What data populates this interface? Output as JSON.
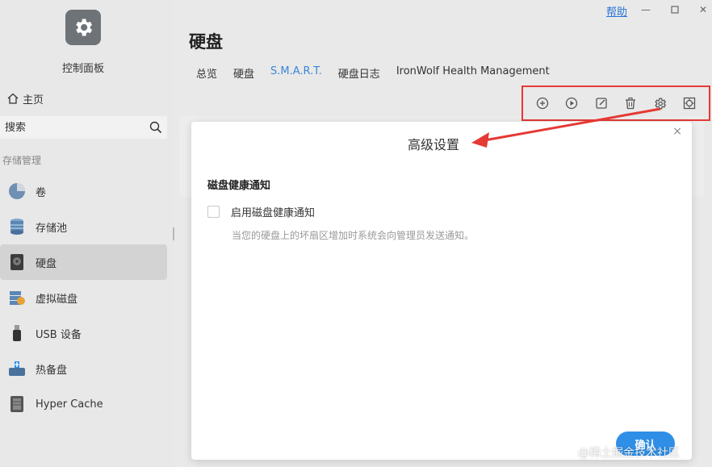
{
  "sidebar": {
    "app_title": "控制面板",
    "home_label": "主页",
    "search_placeholder": "搜索",
    "section_title": "存储管理",
    "items": [
      {
        "label": "卷",
        "icon": "pie-volume-icon"
      },
      {
        "label": "存储池",
        "icon": "storage-pool-icon"
      },
      {
        "label": "硬盘",
        "icon": "hard-disk-icon",
        "active": true
      },
      {
        "label": "虚拟磁盘",
        "icon": "virtual-disk-icon"
      },
      {
        "label": "USB 设备",
        "icon": "usb-icon"
      },
      {
        "label": "热备盘",
        "icon": "hot-spare-icon"
      },
      {
        "label": "Hyper Cache",
        "icon": "hyper-cache-icon"
      }
    ]
  },
  "header": {
    "help_label": "帮助",
    "page_title": "硬盘",
    "tabs": [
      {
        "label": "总览"
      },
      {
        "label": "硬盘"
      },
      {
        "label": "S.M.A.R.T.",
        "active": true
      },
      {
        "label": "硬盘日志"
      },
      {
        "label": "IronWolf Health Management"
      }
    ]
  },
  "toolbar": {
    "buttons": [
      "add-icon",
      "play-icon",
      "edit-icon",
      "trash-icon",
      "settings-icon",
      "locate-icon"
    ]
  },
  "modal": {
    "title": "高级设置",
    "close": "×",
    "section_title": "磁盘健康通知",
    "checkbox_label": "启用磁盘健康通知",
    "checkbox_checked": false,
    "description": "当您的硬盘上的坏扇区增加时系统会向管理员发送通知。",
    "confirm_label": "确认"
  },
  "watermark": "@稀土掘金技术社区",
  "colors": {
    "accent": "#2f8fe6",
    "annotation_red": "#e53935",
    "active_tab": "#3a86d8"
  }
}
